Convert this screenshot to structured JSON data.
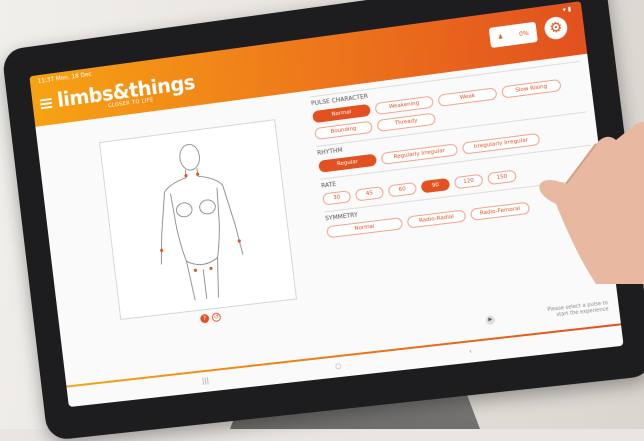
{
  "status_bar": {
    "time": "11:37 Mon, 18 Dec",
    "signal": "▾ ▮"
  },
  "header": {
    "logo": "limbs&things",
    "tagline": "CLOSER TO LIFE",
    "badge_value": "0%"
  },
  "pulse_character": {
    "title": "PULSE CHARACTER",
    "options": [
      "Normal",
      "Weakening",
      "Weak",
      "Slow Rising",
      "Bounding",
      "Thready"
    ],
    "selected": "Normal"
  },
  "rhythm": {
    "title": "RHYTHM",
    "options": [
      "Regular",
      "Regularly Irregular",
      "Irregularly Irregular"
    ],
    "selected": "Regular"
  },
  "rate": {
    "title": "RATE",
    "options": [
      "30",
      "45",
      "60",
      "90",
      "120",
      "150"
    ],
    "selected": "90"
  },
  "symmetry": {
    "title": "SYMMETRY",
    "options": [
      "Normal",
      "Radio-Radial",
      "Radio-Femoral"
    ]
  },
  "footer": {
    "hint": "Please select a pulse to start the experience"
  },
  "nav": {
    "recent": "|||",
    "home": "○",
    "back": "‹"
  },
  "colors": {
    "accent": "#e2511f",
    "accent_start": "#f6a313"
  }
}
